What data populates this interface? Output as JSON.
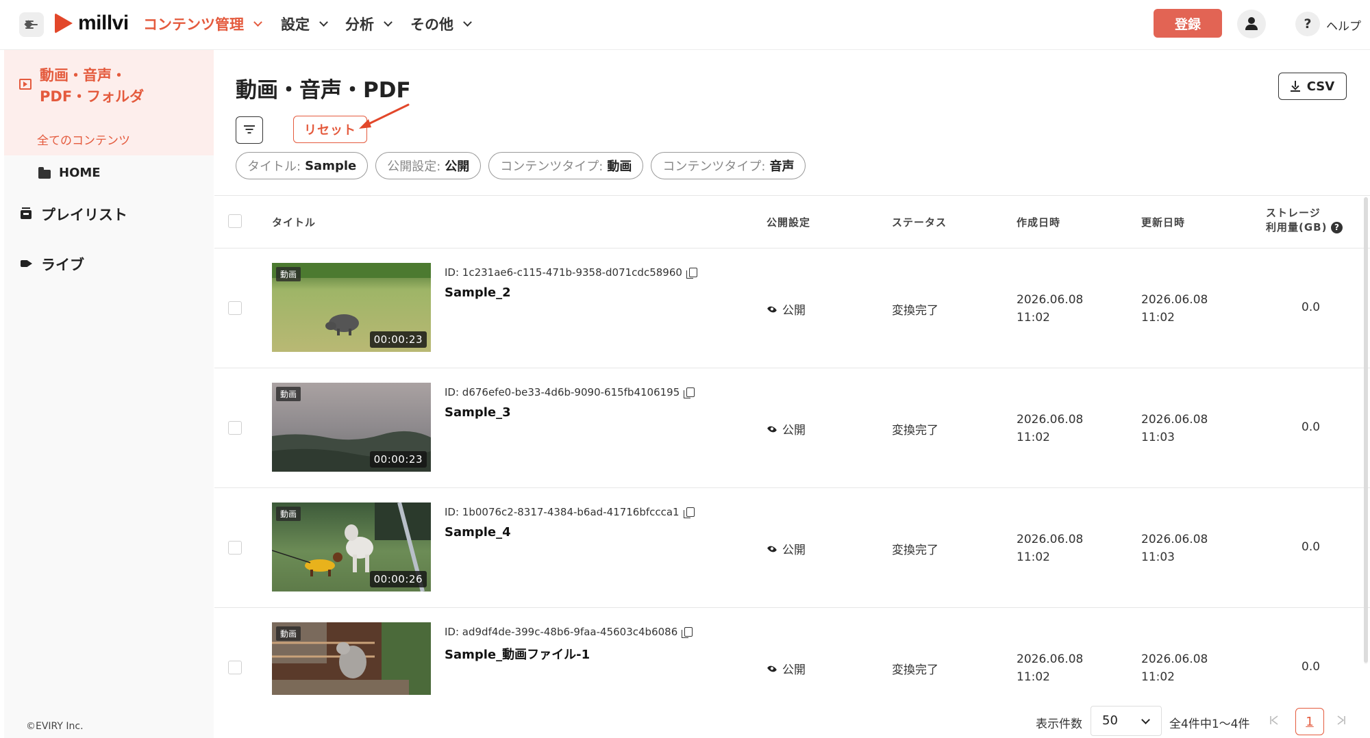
{
  "header": {
    "logo": "millvi",
    "nav": [
      {
        "label": "コンテンツ管理",
        "active": true
      },
      {
        "label": "設定"
      },
      {
        "label": "分析"
      },
      {
        "label": "その他"
      }
    ],
    "register_label": "登録",
    "help_label": "ヘルプ",
    "help_icon": "?"
  },
  "sidebar": {
    "section_line1": "動画・音声・",
    "section_line2": "PDF・フォルダ",
    "all_contents": "全てのコンテンツ",
    "home": "HOME",
    "playlist": "プレイリスト",
    "live": "ライブ",
    "copyright": "©EVIRY Inc."
  },
  "main": {
    "title": "動画・音声・PDF",
    "csv_label": "CSV",
    "reset_label": "リセット",
    "chips": [
      {
        "key": "タイトル:",
        "value": "Sample"
      },
      {
        "key": "公開設定:",
        "value": "公開"
      },
      {
        "key": "コンテンツタイプ:",
        "value": "動画"
      },
      {
        "key": "コンテンツタイプ:",
        "value": "音声"
      }
    ]
  },
  "table": {
    "columns": {
      "title": "タイトル",
      "publish": "公開設定",
      "status": "ステータス",
      "created": "作成日時",
      "updated": "更新日時",
      "storage_line1": "ストレージ",
      "storage_line2": "利用量(GB)"
    },
    "help_icon": "?",
    "rows": [
      {
        "badge": "動画",
        "duration": "00:00:23",
        "id": "ID: 1c231ae6-c115-471b-9358-d071cdc58960",
        "name": "Sample_2",
        "publish": "公開",
        "status": "変換完了",
        "created_date": "2026.06.08",
        "created_time": "11:02",
        "updated_date": "2026.06.08",
        "updated_time": "11:02",
        "storage": "0.0"
      },
      {
        "badge": "動画",
        "duration": "00:00:23",
        "id": "ID: d676efe0-be33-4d6b-9090-615fb4106195",
        "name": "Sample_3",
        "publish": "公開",
        "status": "変換完了",
        "created_date": "2026.06.08",
        "created_time": "11:02",
        "updated_date": "2026.06.08",
        "updated_time": "11:03",
        "storage": "0.0"
      },
      {
        "badge": "動画",
        "duration": "00:00:26",
        "id": "ID: 1b0076c2-8317-4384-b6ad-41716bfccca1",
        "name": "Sample_4",
        "publish": "公開",
        "status": "変換完了",
        "created_date": "2026.06.08",
        "created_time": "11:02",
        "updated_date": "2026.06.08",
        "updated_time": "11:03",
        "storage": "0.0"
      },
      {
        "badge": "動画",
        "duration": "",
        "id": "ID: ad9df4de-399c-48b6-9faa-45603c4b6086",
        "name": "Sample_動画ファイル-1",
        "publish": "公開",
        "status": "変換完了",
        "created_date": "2026.06.08",
        "created_time": "11:02",
        "updated_date": "2026.06.08",
        "updated_time": "11:02",
        "storage": "0.0"
      }
    ]
  },
  "pagination": {
    "per_page_label": "表示件数",
    "per_page_value": "50",
    "total_label": "全4件中1〜4件",
    "current_page": "1"
  },
  "colors": {
    "accent": "#e45a3d",
    "register": "#e26454"
  }
}
